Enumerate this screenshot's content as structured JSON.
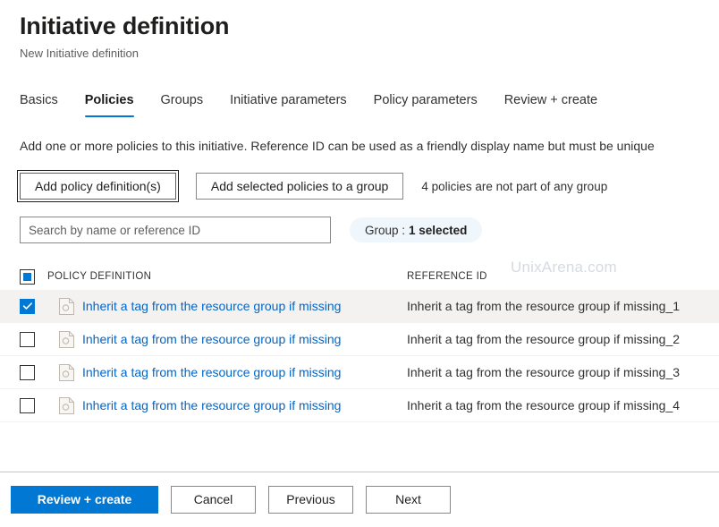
{
  "header": {
    "title": "Initiative definition",
    "subtitle": "New Initiative definition"
  },
  "tabs": [
    {
      "label": "Basics",
      "selected": false
    },
    {
      "label": "Policies",
      "selected": true
    },
    {
      "label": "Groups",
      "selected": false
    },
    {
      "label": "Initiative parameters",
      "selected": false
    },
    {
      "label": "Policy parameters",
      "selected": false
    },
    {
      "label": "Review + create",
      "selected": false
    }
  ],
  "description": "Add one or more policies to this initiative. Reference ID can be used as a friendly display name but must be unique",
  "commandbar": {
    "add_policy_definitions_label": "Add policy definition(s)",
    "add_selected_to_group_label": "Add selected policies to a group",
    "group_note": "4 policies are not part of any group"
  },
  "filters": {
    "search_placeholder": "Search by name or reference ID",
    "search_value": "",
    "group_filter_label": "Group :",
    "group_filter_value": "1 selected"
  },
  "watermark": "UnixArena.com",
  "table": {
    "columns": {
      "policy_definition": "POLICY DEFINITION",
      "reference_id": "REFERENCE ID"
    },
    "select_all_state": "indeterminate",
    "rows": [
      {
        "checked": true,
        "name": "Inherit a tag from the resource group if missing",
        "reference_id": "Inherit a tag from the resource group if missing_1"
      },
      {
        "checked": false,
        "name": "Inherit a tag from the resource group if missing",
        "reference_id": "Inherit a tag from the resource group if missing_2"
      },
      {
        "checked": false,
        "name": "Inherit a tag from the resource group if missing",
        "reference_id": "Inherit a tag from the resource group if missing_3"
      },
      {
        "checked": false,
        "name": "Inherit a tag from the resource group if missing",
        "reference_id": "Inherit a tag from the resource group if missing_4"
      }
    ]
  },
  "footer": {
    "review_create_label": "Review + create",
    "cancel_label": "Cancel",
    "previous_label": "Previous",
    "next_label": "Next"
  },
  "colors": {
    "accent": "#0078d4",
    "link": "#0066cc",
    "pill_bg": "#eff6fc",
    "row_selected_bg": "#f3f2f1",
    "watermark": "#d6dae2"
  }
}
